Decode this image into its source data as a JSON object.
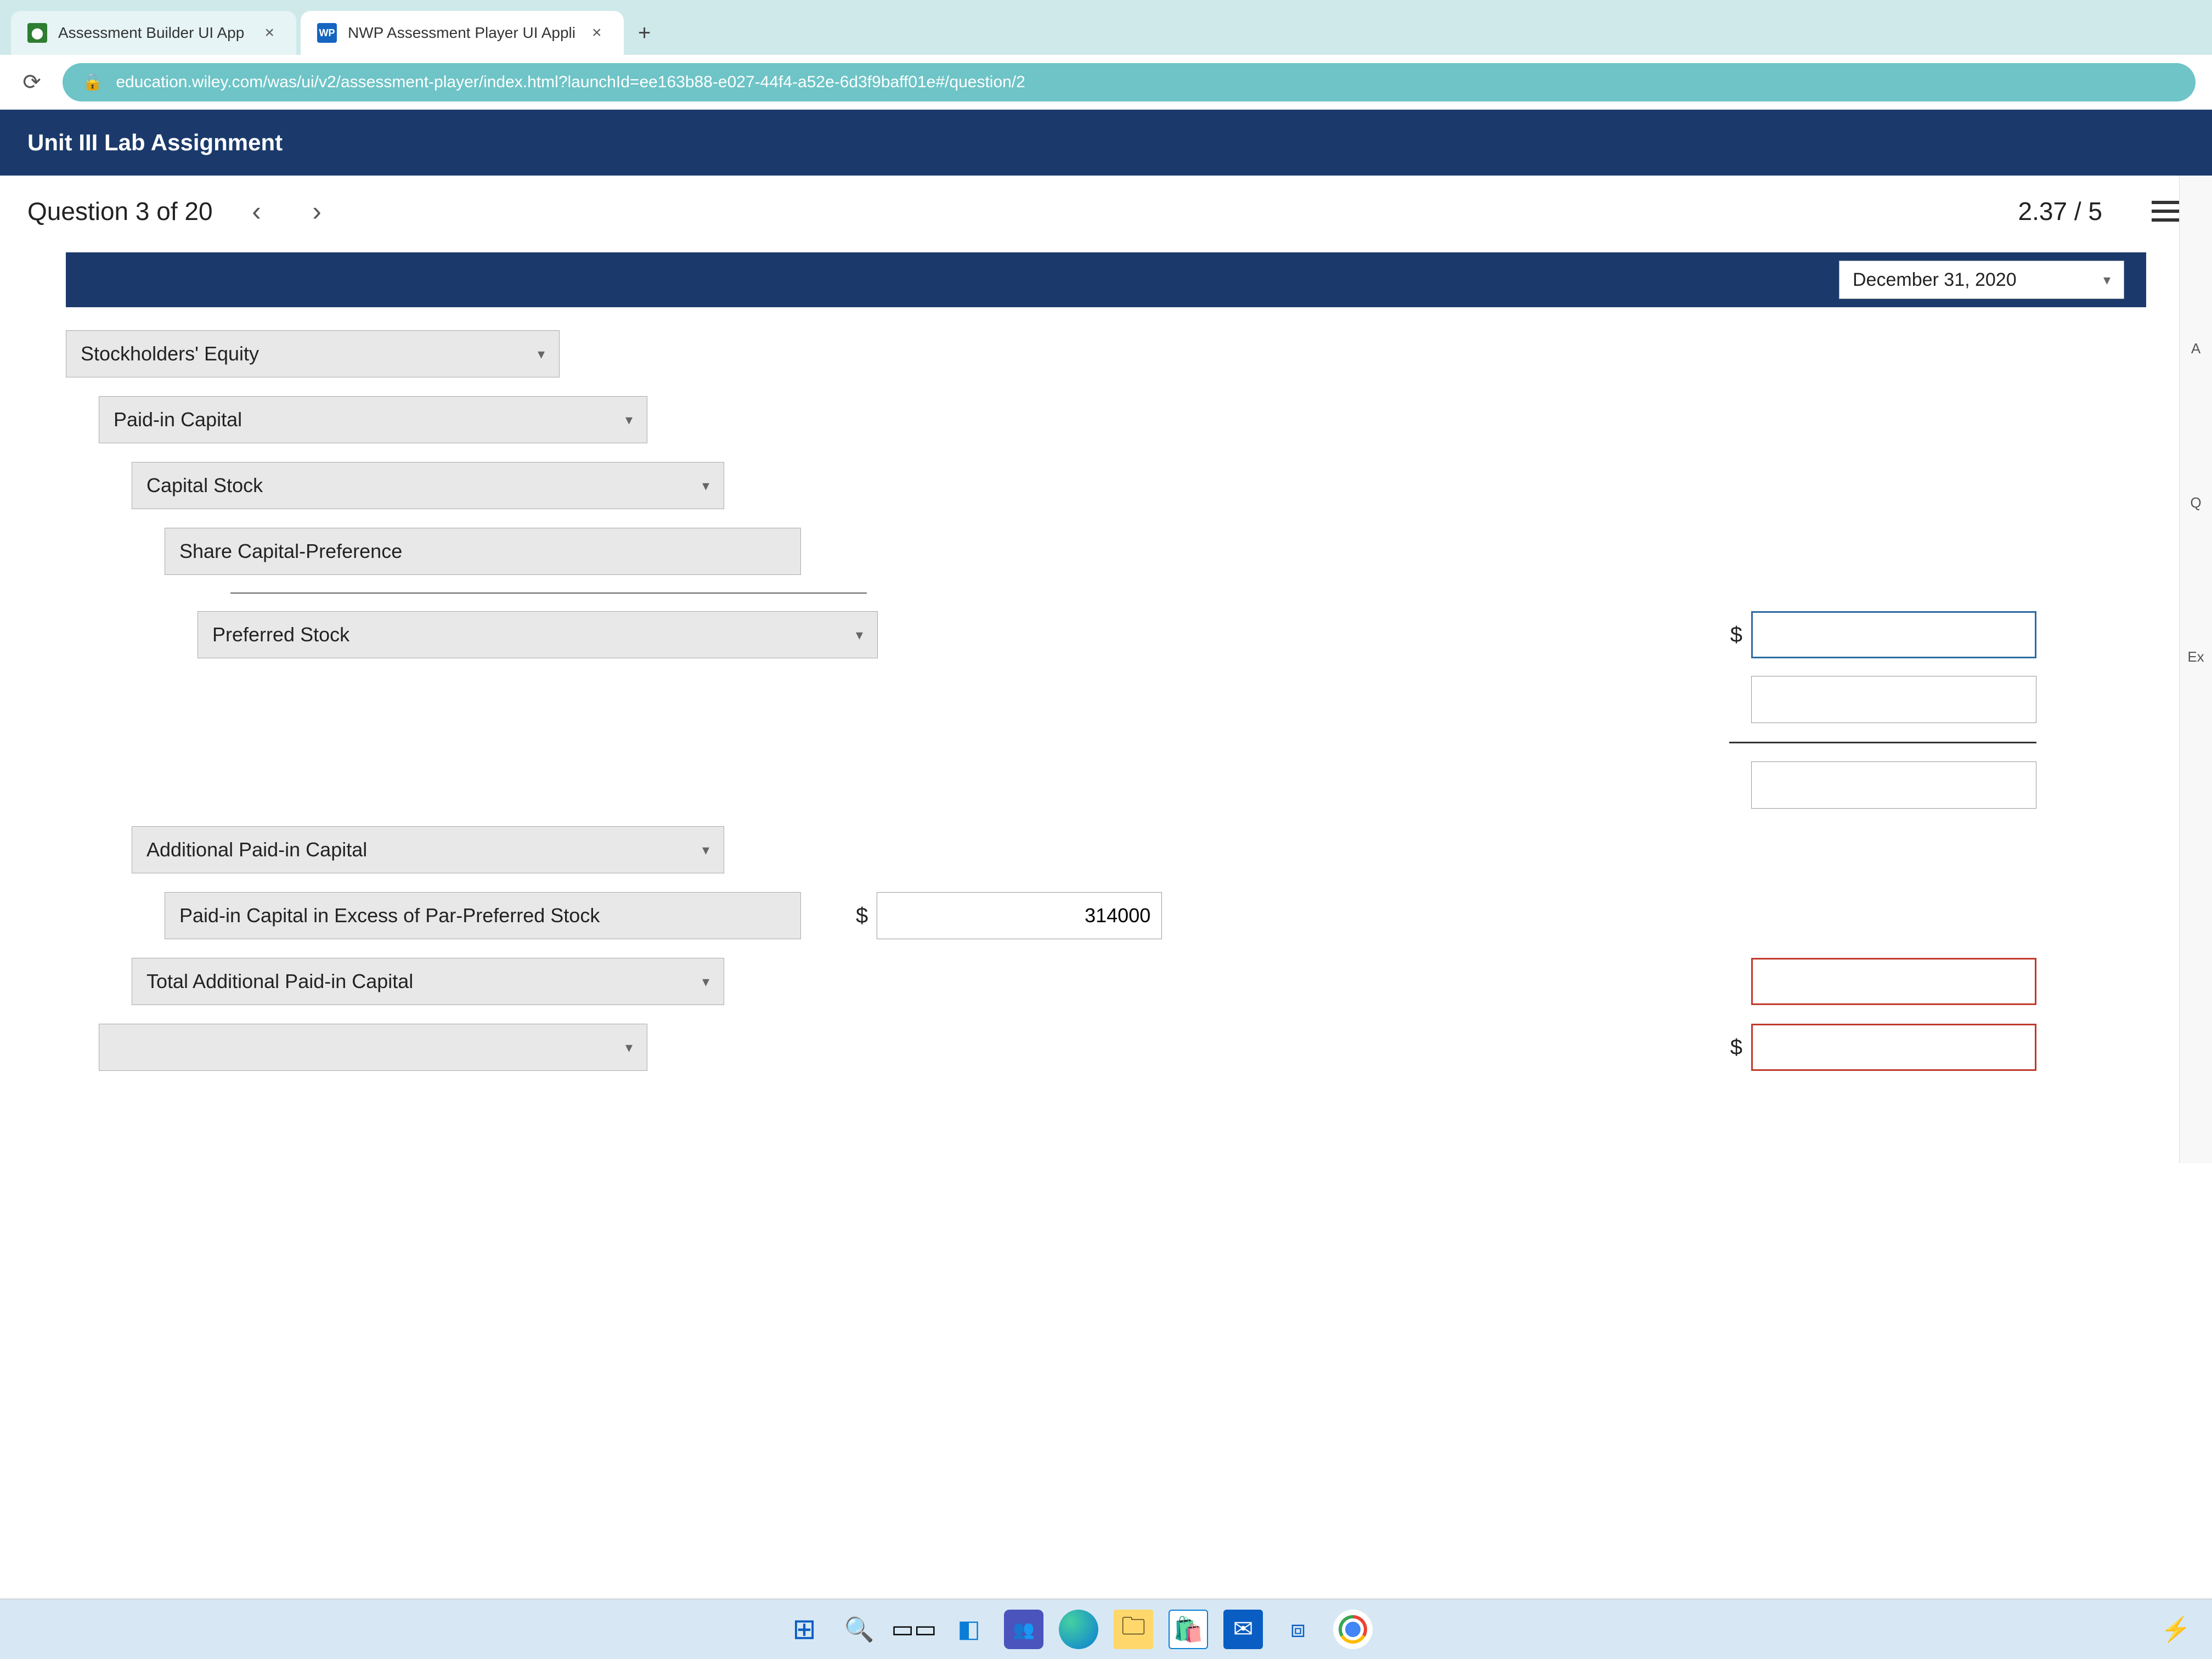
{
  "browser": {
    "tabs": [
      {
        "label": "Assessment Builder UI App"
      },
      {
        "label": "NWP Assessment Player UI Appli"
      }
    ],
    "url": "education.wiley.com/was/ui/v2/assessment-player/index.html?launchId=ee163b88-e027-44f4-a52e-6d3f9baff01e#/question/2",
    "new_tab": "+"
  },
  "app": {
    "title": "Unit III Lab Assignment"
  },
  "question": {
    "counter": "Question 3 of 20",
    "prev": "‹",
    "next": "›",
    "score": "2.37 / 5"
  },
  "sheet": {
    "date": "December 31, 2020",
    "rows": {
      "r1": "Stockholders' Equity",
      "r2": "Paid-in Capital",
      "r3": "Capital Stock",
      "r4": "Share Capital-Preference",
      "r5": "Preferred Stock",
      "r6": "Additional Paid-in Capital",
      "r7": "Paid-in Capital in Excess of Par-Preferred Stock",
      "r8": "Total Additional Paid-in Capital",
      "r9": ""
    },
    "amounts": {
      "a5": "",
      "a7": "314000",
      "t1": "",
      "t2": ""
    },
    "dollar": "$"
  },
  "taskbar": {
    "start": "⊞",
    "search": "🔍"
  },
  "right_sliver": {
    "a": "A",
    "q": "Q",
    "e": "Ex"
  }
}
